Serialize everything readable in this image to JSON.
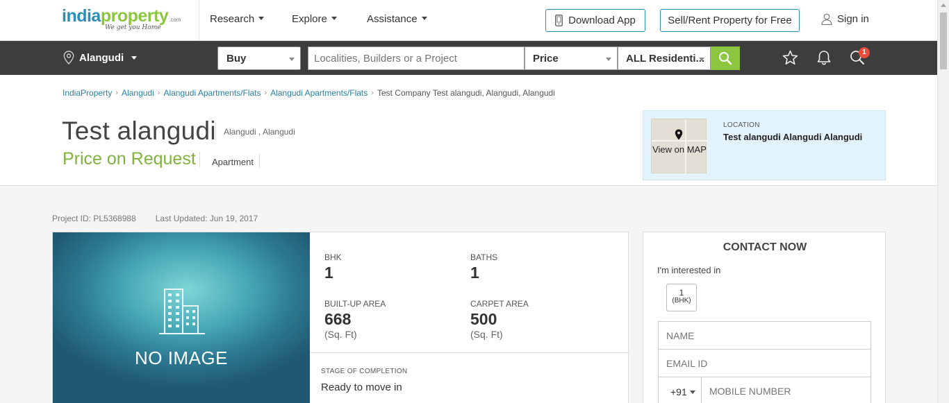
{
  "header": {
    "logo_word1": "india",
    "logo_word2": "property",
    "logo_suffix": ".com",
    "logo_tagline": "We get you Home",
    "nav": [
      {
        "label": "Research"
      },
      {
        "label": "Explore"
      },
      {
        "label": "Assistance"
      }
    ],
    "download_app": "Download App",
    "sell_rent": "Sell/Rent Property for Free",
    "sign_in": "Sign in",
    "icons": [
      "phone-icon",
      "user-icon"
    ]
  },
  "searchbar": {
    "location": "Alangudi",
    "mode": "Buy",
    "search_placeholder": "Localities, Builders or a Project",
    "price": "Price",
    "property_type": "ALL Residenti...",
    "notification_count": "1",
    "accent_color": "#8cc63f",
    "icons": [
      "location-pin-icon",
      "search-icon",
      "star-icon",
      "bell-icon",
      "search-history-icon"
    ]
  },
  "breadcrumb": [
    {
      "label": "IndiaProperty"
    },
    {
      "label": "Alangudi"
    },
    {
      "label": "Alangudi Apartments/Flats"
    },
    {
      "label": "Alangudi Apartments/Flats"
    },
    {
      "label": "Test Company Test alangudi, Alangudi, Alangudi"
    }
  ],
  "property": {
    "title": "Test alangudi",
    "subtitle": "Alangudi , Alangudi",
    "price": "Price on Request",
    "type": "Apartment",
    "map_label": "View on MAP",
    "location_label": "LOCATION",
    "location_value": "Test alangudi Alangudi Alangudi",
    "project_id": "Project ID: PL5368988",
    "last_updated": "Last Updated: Jun 19, 2017",
    "no_image": "NO IMAGE",
    "specs": {
      "bhk_label": "BHK",
      "bhk": "1",
      "baths_label": "BATHS",
      "baths": "1",
      "builtup_label": "BUILT-UP AREA",
      "builtup": "668",
      "builtup_unit": "(Sq. Ft)",
      "carpet_label": "CARPET AREA",
      "carpet": "500",
      "carpet_unit": "(Sq. Ft)"
    },
    "stage_label": "STAGE OF COMPLETION",
    "stage_value": "Ready to move in"
  },
  "contact": {
    "title": "CONTACT NOW",
    "interested": "I'm interested in",
    "bhk_option": "1",
    "bhk_option_sub": "(BHK)",
    "name_placeholder": "NAME",
    "email_placeholder": "EMAIL ID",
    "country_code": "+91",
    "mobile_placeholder": "MOBILE NUMBER"
  }
}
